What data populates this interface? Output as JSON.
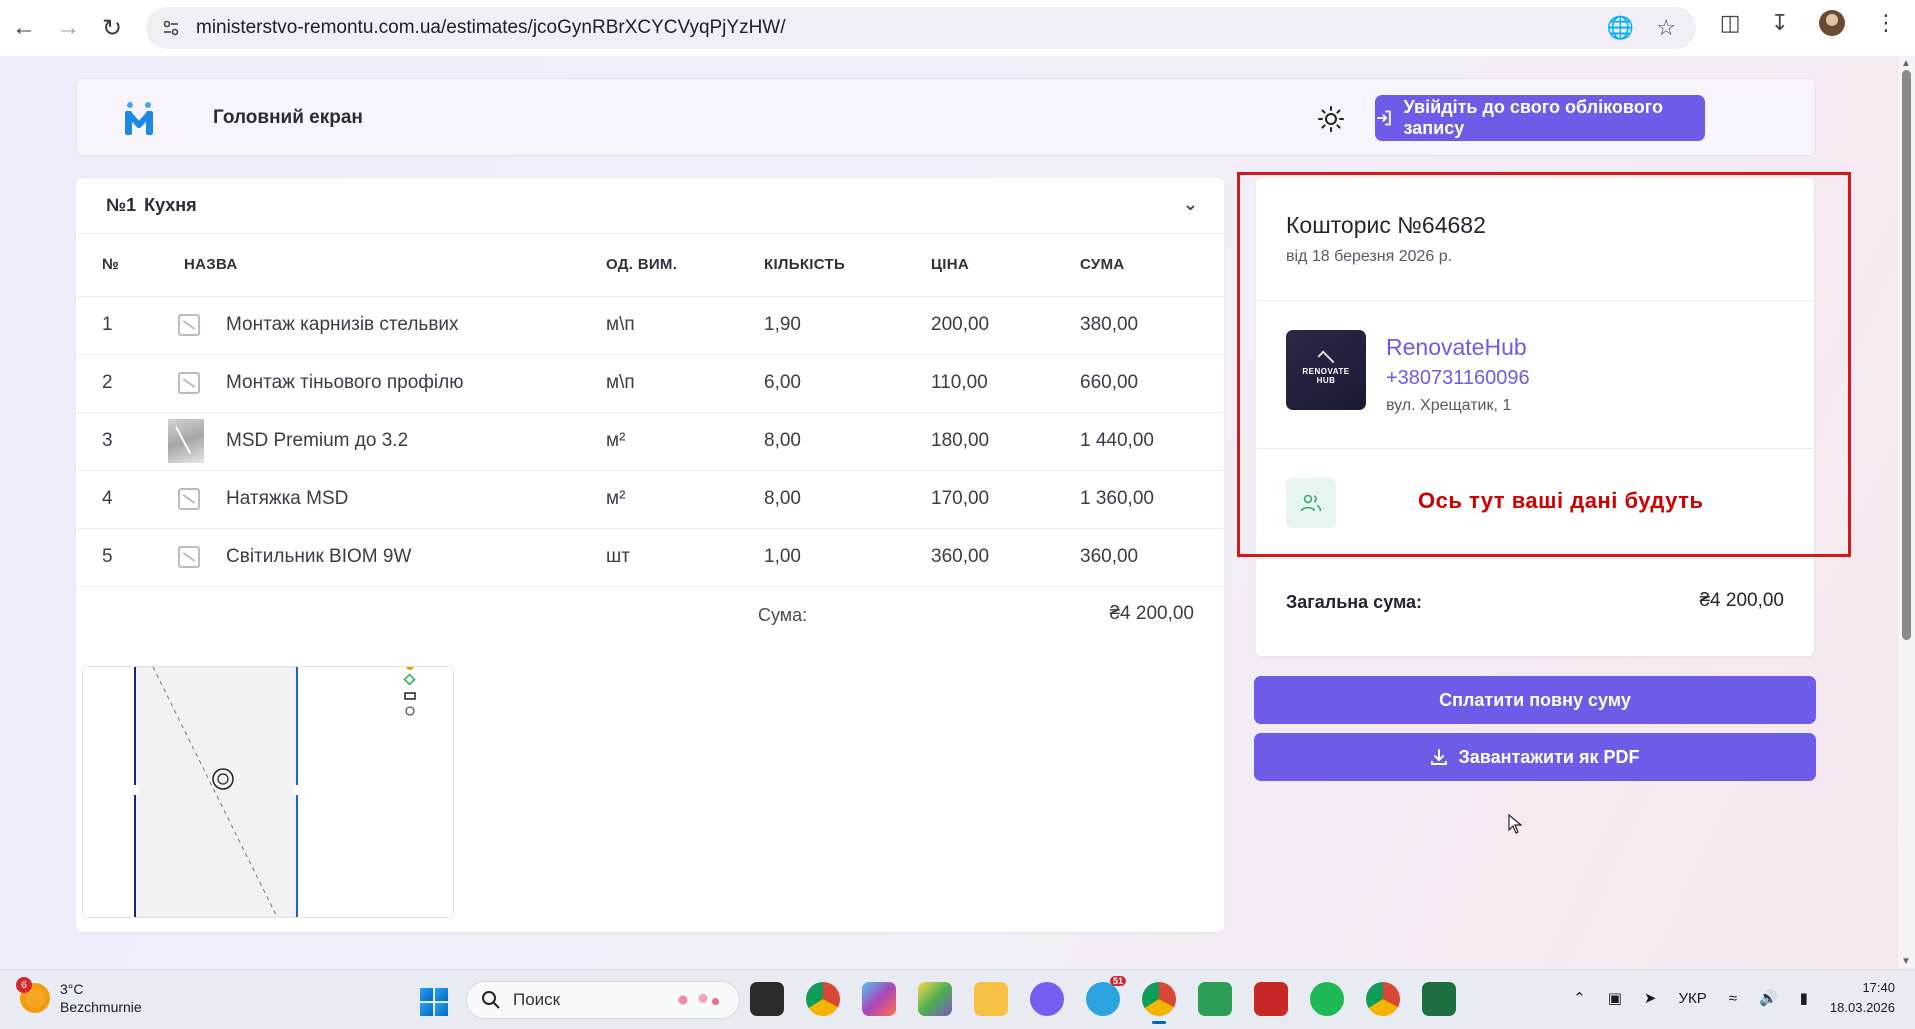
{
  "browser": {
    "url": "ministerstvo-remontu.com.ua/estimates/jcoGynRBrXCYCVyqPjYzHW/"
  },
  "header": {
    "title": "Головний екран",
    "login_label": "Увійдіть до свого облікового запису"
  },
  "room": {
    "number": "№1",
    "name": "Кухня"
  },
  "table": {
    "columns": [
      "№",
      "НАЗВА",
      "ОД. ВИМ.",
      "КІЛЬКІСТЬ",
      "ЦІНА",
      "СУМА"
    ],
    "rows": [
      {
        "num": "1",
        "name": "Монтаж карнизів стельвих",
        "unit": "м\\п",
        "qty": "1,90",
        "price": "200,00",
        "sum": "380,00",
        "image": "placeholder"
      },
      {
        "num": "2",
        "name": "Монтаж тіньового профілю",
        "unit": "м\\п",
        "qty": "6,00",
        "price": "110,00",
        "sum": "660,00",
        "image": "placeholder"
      },
      {
        "num": "3",
        "name": "MSD Premium до 3.2",
        "unit": "м²",
        "qty": "8,00",
        "price": "180,00",
        "sum": "1 440,00",
        "image": "photo"
      },
      {
        "num": "4",
        "name": "Натяжка MSD",
        "unit": "м²",
        "qty": "8,00",
        "price": "170,00",
        "sum": "1 360,00",
        "image": "placeholder"
      },
      {
        "num": "5",
        "name": "Світильник BIOM 9W",
        "unit": "шт",
        "qty": "1,00",
        "price": "360,00",
        "sum": "360,00",
        "image": "placeholder"
      }
    ],
    "sum_label": "Сума:",
    "sum_value": "₴4 200,00"
  },
  "estimate": {
    "title": "Кошторис №64682",
    "date": "від 18 березня 2026 р.",
    "company": {
      "logo_text_1": "RENOVATE",
      "logo_text_2": "HUB",
      "name": "RenovateHub",
      "phone": "+380731160096",
      "address": "вул. Хрещатик, 1"
    },
    "client_placeholder": "Ось тут ваші дані будуть",
    "total_label": "Загальна сума:",
    "total_value": "₴4 200,00"
  },
  "actions": {
    "pay_label": "Сплатити повну суму",
    "pdf_label": "Завантажити як PDF"
  },
  "taskbar": {
    "weather_temp": "3°C",
    "weather_place": "Bezchmurnie",
    "weather_badge": "6",
    "search_placeholder": "Поиск",
    "telegram_badge": "51",
    "language": "УКР",
    "time": "17:40",
    "date": "18.03.2026"
  },
  "colors": {
    "accent": "#6c5ce7",
    "highlight_frame": "#cf1b1b",
    "placeholder_text": "#d00000"
  }
}
